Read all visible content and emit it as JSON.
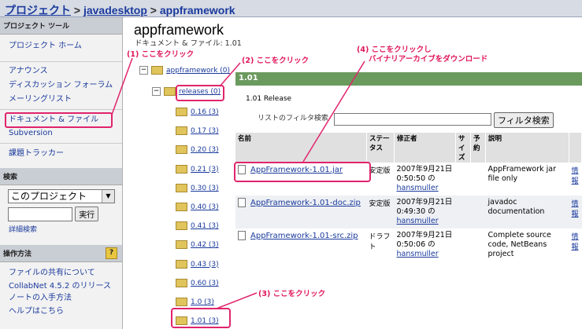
{
  "breadcrumb": {
    "root": "プロジェクト",
    "sep": ">",
    "project": "javadesktop",
    "current": "appframework"
  },
  "sidebar": {
    "tools_header": "プロジェクト ツール",
    "project_home": "プロジェクト ホーム",
    "announce": "アナウンス",
    "discussion": "ディスカッション フォーラム",
    "mailing": "メーリングリスト",
    "docs_files": "ドキュメント & ファイル",
    "subversion": "Subversion",
    "issue_tracker": "課題トラッカー",
    "search_header": "検索",
    "search_scope": "このプロジェクト",
    "search_button": "実行",
    "advanced_search": "詳細検索",
    "howto_header": "操作方法",
    "help_q": "?",
    "howto1": "ファイルの共有について",
    "howto2a": "CollabNet 4.5.2 のリリース",
    "howto2b": "ノートの入手方法",
    "howto3": "ヘルプはこちら"
  },
  "main": {
    "title": "appframework",
    "subtitle": "ドキュメント & ファイル: 1.01",
    "tree": {
      "root": "appframework (0)",
      "releases": "releases (0)",
      "folders": [
        "0.16 (3)",
        "0.17 (3)",
        "0.20 (3)",
        "0.21 (3)",
        "0.30 (3)",
        "0.40 (3)",
        "0.41 (3)",
        "0.42 (3)",
        "0.43 (3)",
        "0.60 (3)",
        "1.0 (3)",
        "1.01 (3)"
      ]
    },
    "release_bar": "1.01",
    "release_desc": "1.01 Release",
    "filter_label": "リストのフィルタ検索",
    "filter_button": "フィルタ検索",
    "columns": [
      "名前",
      "ステータス",
      "修正者",
      "サイズ",
      "予約",
      "説明"
    ],
    "files": [
      {
        "name": "AppFramework-1.01.jar",
        "status": "安定版",
        "date1": "2007年9月21日",
        "date2": "0:50:50 の",
        "user": "hansmuller",
        "desc": "AppFramework jar file only",
        "info": "情報"
      },
      {
        "name": "AppFramework-1.01-doc.zip",
        "status": "安定版",
        "date1": "2007年9月21日",
        "date2": "0:49:30 の",
        "user": "hansmuller",
        "desc": "javadoc documentation",
        "info": "情報"
      },
      {
        "name": "AppFramework-1.01-src.zip",
        "status": "ドラフト",
        "date1": "2007年9月21日",
        "date2": "0:50:06 の",
        "user": "hansmuller",
        "desc": "Complete source code, NetBeans project",
        "info": "情報"
      }
    ]
  },
  "annotations": {
    "a1": "(1) ここをクリック",
    "a2": "(2) ここをクリック",
    "a3": "(3) ここをクリック",
    "a4_line1": "(4) ここをクリックし",
    "a4_line2": "バイナリアーカイブをダウンロード"
  },
  "colors": {
    "annotation": "#e0246c",
    "bar": "#6b9a5e",
    "link": "#1a3a9c"
  }
}
